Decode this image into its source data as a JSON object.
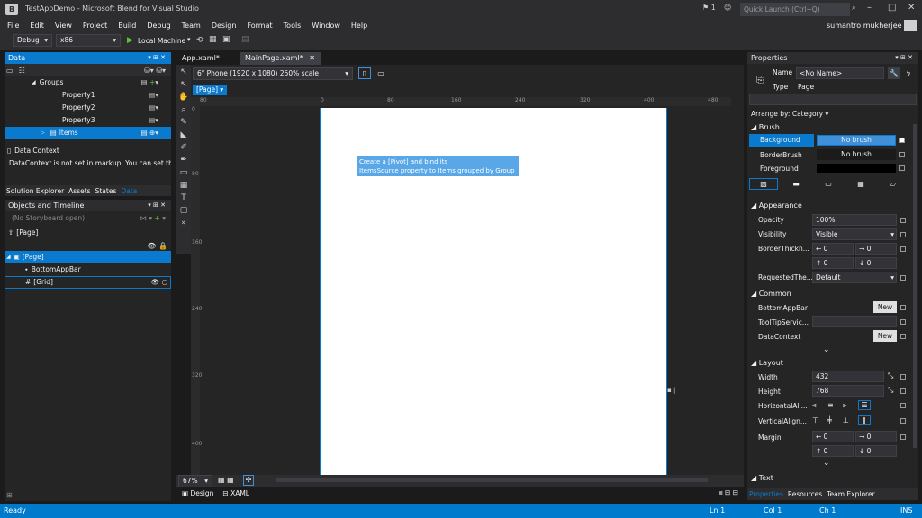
{
  "window": {
    "title": "TestAppDemo - Microsoft Blend for Visual Studio",
    "logo": "B",
    "notifications": "1",
    "quick_launch_placeholder": "Quick Launch (Ctrl+Q)",
    "user": "sumantro mukherjee"
  },
  "menu": [
    "File",
    "Edit",
    "View",
    "Project",
    "Build",
    "Debug",
    "Team",
    "Design",
    "Format",
    "Tools",
    "Window",
    "Help"
  ],
  "toolbar": {
    "config": "Debug",
    "platform": "x86",
    "run_label": "Local Machine"
  },
  "data_panel": {
    "title": "Data",
    "tree": [
      {
        "label": "Groups"
      },
      {
        "label": "Property1"
      },
      {
        "label": "Property2"
      },
      {
        "label": "Property3"
      },
      {
        "label": "Items"
      }
    ],
    "context_title": "Data Context",
    "context_msg": "DataContext is not set in markup. You can set the",
    "tabs": [
      "Solution Explorer",
      "Assets",
      "States",
      "Data"
    ]
  },
  "objects_panel": {
    "title": "Objects and Timeline",
    "storyboard": "(No Storyboard open)",
    "root": "[Page]",
    "tree": [
      {
        "label": "[Page]"
      },
      {
        "label": "BottomAppBar"
      },
      {
        "label": "[Grid]"
      }
    ]
  },
  "document": {
    "tabs": [
      "App.xaml*",
      "MainPage.xaml*"
    ],
    "device": "6\" Phone (1920 x 1080) 250% scale",
    "breadcrumb": "[Page]",
    "ruler_h": [
      "80",
      "0",
      "80",
      "160",
      "240",
      "320",
      "400",
      "480"
    ],
    "ruler_v": [
      "0",
      "80",
      "160",
      "240",
      "320",
      "400"
    ],
    "tooltip_line1": "Create a [Pivot] and bind its",
    "tooltip_line2": "ItemsSource property to Items grouped by Group",
    "zoom": "67%",
    "view_tabs": [
      "Design",
      "XAML"
    ]
  },
  "properties": {
    "title": "Properties",
    "name_label": "Name",
    "name_value": "<No Name>",
    "type_label": "Type",
    "type_value": "Page",
    "arrange": "Arrange by: Category",
    "brush": {
      "header": "Brush",
      "rows": [
        {
          "label": "Background",
          "value": "No brush"
        },
        {
          "label": "BorderBrush",
          "value": "No brush"
        },
        {
          "label": "Foreground",
          "value": ""
        }
      ]
    },
    "appearance": {
      "header": "Appearance",
      "opacity_label": "Opacity",
      "opacity": "100%",
      "visibility_label": "Visibility",
      "visibility": "Visible",
      "border_label": "BorderThickn...",
      "border_left": "0",
      "border_right": "0",
      "border_top": "0",
      "border_bottom": "0",
      "theme_label": "RequestedThe...",
      "theme": "Default"
    },
    "common": {
      "header": "Common",
      "bottom_label": "BottomAppBar",
      "bottom_btn": "New",
      "tooltip_label": "ToolTipServic...",
      "datacontext_label": "DataContext",
      "datacontext_btn": "New"
    },
    "layout": {
      "header": "Layout",
      "width_label": "Width",
      "width": "432",
      "height_label": "Height",
      "height": "768",
      "halign_label": "HorizontalAli...",
      "valign_label": "VerticalAlign...",
      "margin_label": "Margin",
      "m_left": "0",
      "m_right": "0",
      "m_top": "0",
      "m_bottom": "0"
    },
    "text_header": "Text",
    "tabs": [
      "Properties",
      "Resources",
      "Team Explorer"
    ]
  },
  "status": {
    "left": "Ready",
    "ln": "Ln 1",
    "col": "Col 1",
    "ch": "Ch 1",
    "ins": "INS"
  },
  "colors": {
    "accent": "#007acc",
    "bg": "#1b1b1c",
    "chrome": "#2d2d30",
    "artboard": "#ffffff"
  }
}
